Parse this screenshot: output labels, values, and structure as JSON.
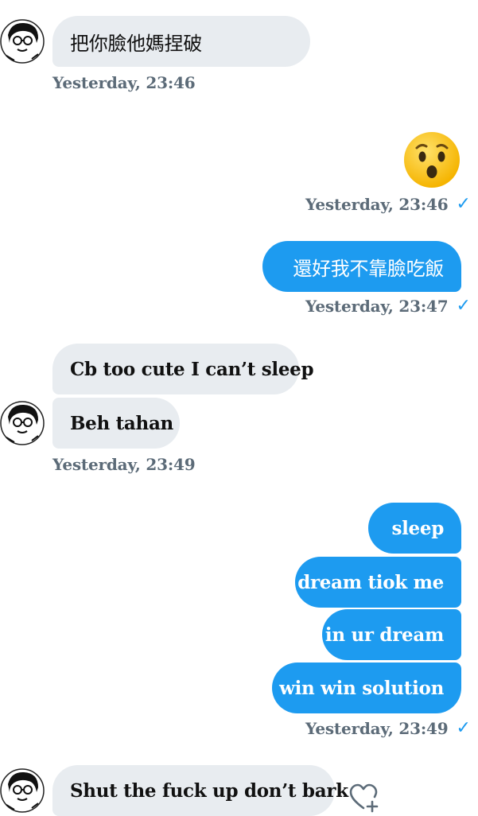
{
  "colors": {
    "outgoing_bubble": "#1d9bf0",
    "incoming_bubble": "#e8ecf0",
    "timestamp": "#5c6b78",
    "check": "#1d9bf0"
  },
  "messages": [
    {
      "text": "把你臉他媽捏破",
      "direction": "in"
    },
    {
      "timestamp": "Yesterday, 23:46"
    },
    {
      "emoji": "hushed-face",
      "direction": "out"
    },
    {
      "timestamp": "Yesterday, 23:46",
      "read": true
    },
    {
      "text": "還好我不靠臉吃飯",
      "direction": "out"
    },
    {
      "timestamp": "Yesterday, 23:47",
      "read": true
    },
    {
      "text": "Cb too cute I can’t sleep",
      "direction": "in"
    },
    {
      "text": "Beh tahan",
      "direction": "in"
    },
    {
      "timestamp": "Yesterday, 23:49"
    },
    {
      "text": "sleep",
      "direction": "out"
    },
    {
      "text": "dream tiok me",
      "direction": "out"
    },
    {
      "text": "in ur dream",
      "direction": "out"
    },
    {
      "text": "win win solution",
      "direction": "out"
    },
    {
      "timestamp": "Yesterday, 23:49",
      "read": true
    },
    {
      "text": "Shut the fuck up don’t bark",
      "direction": "in"
    }
  ],
  "icons": {
    "avatar": "avatar-icon",
    "read": "check-icon",
    "react": "heart-add-icon",
    "emoji": "hushed-face-emoji"
  }
}
